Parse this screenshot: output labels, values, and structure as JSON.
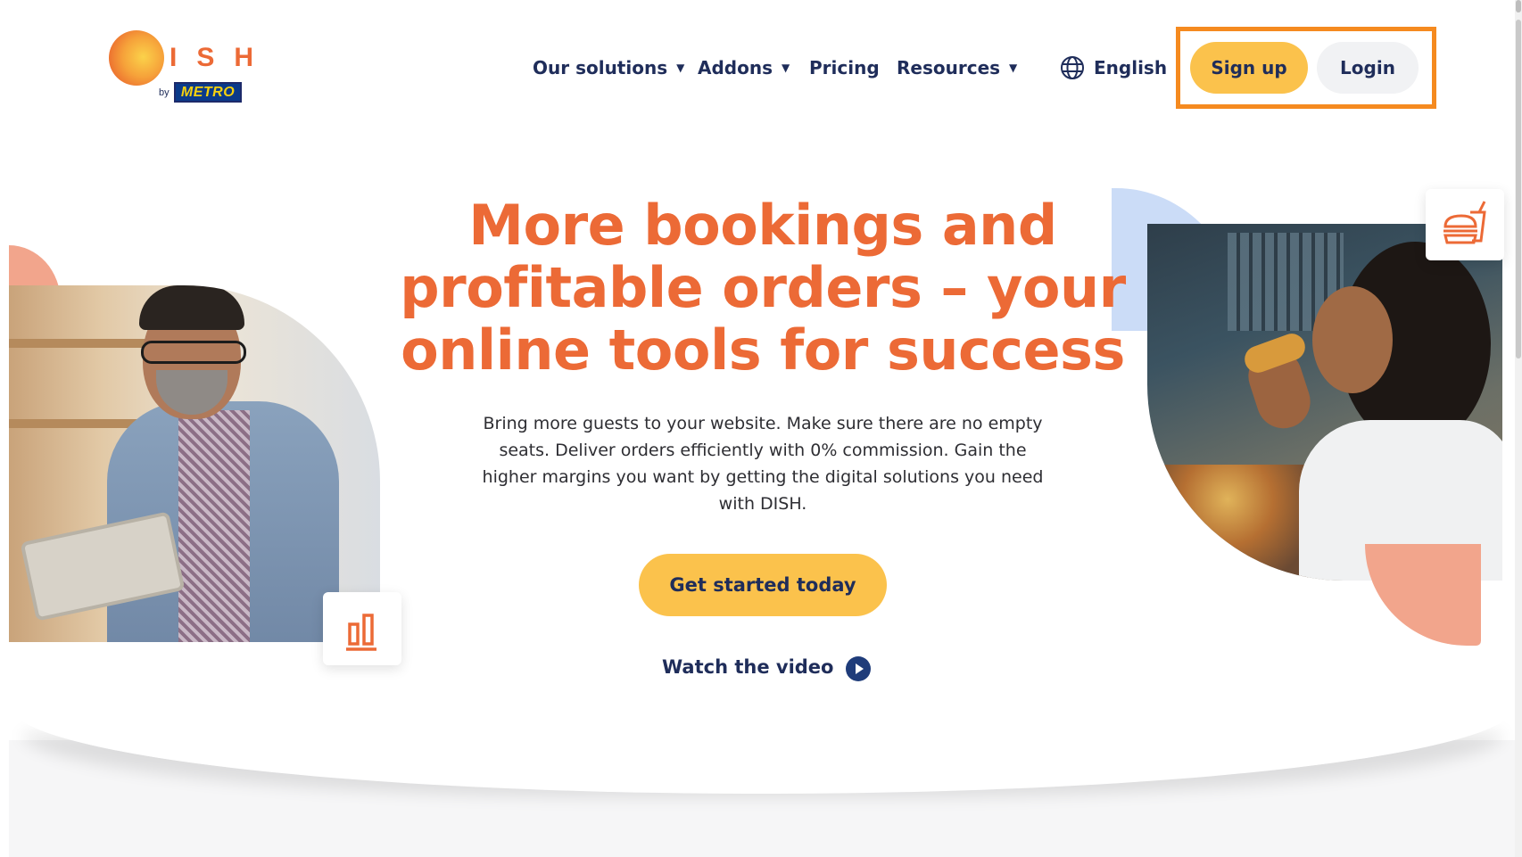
{
  "brand": {
    "logo_letters": "ISH",
    "logo_by": "by",
    "logo_metro": "METRO",
    "colors": {
      "accent_orange": "#ec6a36",
      "button_yellow": "#fbc24c",
      "navy": "#1f2d5a",
      "highlight": "#f58a1f"
    }
  },
  "nav": {
    "items": [
      {
        "label": "Our solutions",
        "has_dropdown": true
      },
      {
        "label": "Addons",
        "has_dropdown": true
      },
      {
        "label": "Pricing",
        "has_dropdown": false
      },
      {
        "label": "Resources",
        "has_dropdown": true
      }
    ],
    "caret": "▼",
    "language": {
      "icon": "globe-icon",
      "label": "English"
    },
    "signup_label": "Sign up",
    "login_label": "Login"
  },
  "hero": {
    "title": "More bookings and profitable orders – your online tools for success",
    "description": "Bring more guests to your website. Make sure there are no empty seats. Deliver orders efficiently with 0% commission. Gain the higher margins you want by getting the digital solutions you need with DISH.",
    "cta_label": "Get started today",
    "video_label": "Watch the video",
    "video_icon": "play-icon",
    "left_badge_icon": "bar-chart-icon",
    "right_badge_icon": "food-drink-icon"
  }
}
